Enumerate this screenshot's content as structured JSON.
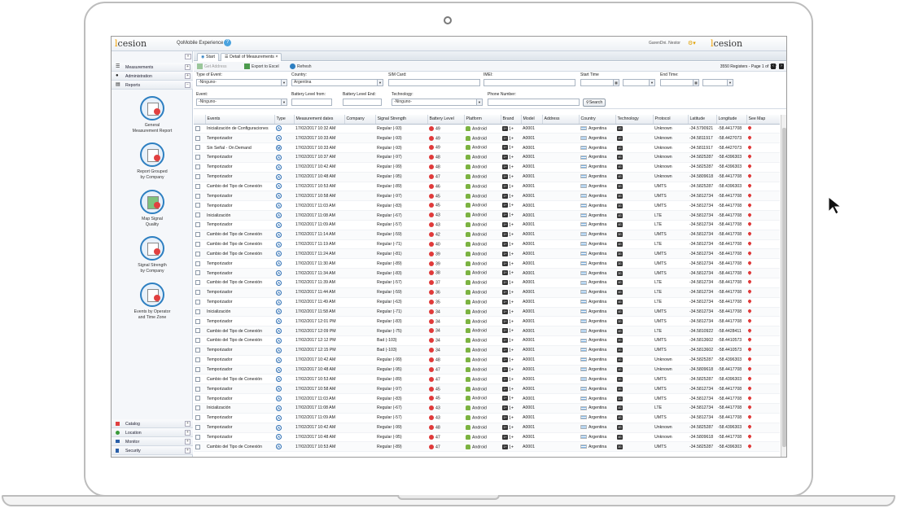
{
  "app": {
    "logo_text": "cesion",
    "title": "QoMobile Experience",
    "user": "GarenDni. Nestor"
  },
  "sidebar": {
    "sections": [
      {
        "label": "Measurements",
        "icon": "list-icon"
      },
      {
        "label": "Administration",
        "icon": "person-icon"
      },
      {
        "label": "Reports",
        "icon": "report-icon"
      }
    ],
    "reports": [
      {
        "label_line1": "General",
        "label_line2": "Measurement Report"
      },
      {
        "label_line1": "Report Grouped",
        "label_line2": "by Company"
      },
      {
        "label_line1": "Map Signal",
        "label_line2": "Quality"
      },
      {
        "label_line1": "Signal Strength",
        "label_line2": "by Company"
      },
      {
        "label_line1": "Events by Operator",
        "label_line2": "and Time Zone"
      }
    ],
    "bottom_sections": [
      {
        "label": "Catalog",
        "color": "#e04040"
      },
      {
        "label": "Location",
        "color": "#3a9a3a"
      },
      {
        "label": "Monitor",
        "color": "#2a5fa8"
      },
      {
        "label": "Security",
        "color": "#2a5fa8"
      }
    ]
  },
  "tabs": [
    {
      "label": "Start"
    },
    {
      "label": "Detail of Measurements"
    }
  ],
  "toolbar": {
    "get_address": "Get Address",
    "export": "Export to Excel",
    "refresh": "Refresh",
    "registers": "3550 Registers - Page 1 of 142"
  },
  "filters": {
    "type_of_event_label": "Type of Event:",
    "type_of_event_value": "-Ninguno-",
    "country_label": "Country:",
    "country_value": "Argentina",
    "sim_label": "SIM Card:",
    "imei_label": "IMEI:",
    "start_time_label": "Start Time",
    "end_time_label": "End Time:",
    "event_label": "Event:",
    "event_value": "-Ninguno-",
    "battery_from_label": "Battery Level from:",
    "battery_end_label": "Battery Level End:",
    "technology_label": "Technology:",
    "technology_value": "-Ninguno-",
    "phone_label": "Phone Number:",
    "search_label": "Search"
  },
  "table": {
    "columns": [
      "Events",
      "Type",
      "Measurement dates",
      "Company",
      "Signal Strength",
      "Battery Level",
      "Platform",
      "Brand",
      "Model",
      "Address",
      "Country",
      "Technology",
      "Protocol",
      "Latitude",
      "Longitude",
      "See Map"
    ],
    "rows": [
      {
        "event": "Inicialización de Configuraciones",
        "type": "A",
        "date": "17/02/2017 10:32 AM",
        "signal": "Regular (-93)",
        "battery": "49",
        "platform": "Android",
        "brand": "1+",
        "model": "A0001",
        "country": "Argentina",
        "tech": "4G",
        "protocol": "Unknown",
        "lat": "-34.5790921",
        "lon": "-58.4417708"
      },
      {
        "event": "Temporizador",
        "type": "A",
        "date": "17/02/2017 10:33 AM",
        "signal": "Regular (-93)",
        "battery": "49",
        "platform": "Android",
        "brand": "1+",
        "model": "A0001",
        "country": "Argentina",
        "tech": "4G",
        "protocol": "Unknown",
        "lat": "-34.5811917",
        "lon": "-58.4427073"
      },
      {
        "event": "Sin Señal - On Demand",
        "type": "M",
        "date": "17/02/2017 10:33 AM",
        "signal": "Regular (-93)",
        "battery": "49",
        "platform": "Android",
        "brand": "1+",
        "model": "A0001",
        "country": "Argentina",
        "tech": "4G",
        "protocol": "Unknown",
        "lat": "-34.5811917",
        "lon": "-58.4427073"
      },
      {
        "event": "Temporizador",
        "type": "A",
        "date": "17/02/2017 10:37 AM",
        "signal": "Regular (-97)",
        "battery": "48",
        "platform": "Android",
        "brand": "1+",
        "model": "A0001",
        "country": "Argentina",
        "tech": "4G",
        "protocol": "Unknown",
        "lat": "-34.5825287",
        "lon": "-58.4396303"
      },
      {
        "event": "Temporizador",
        "type": "A",
        "date": "17/02/2017 10:42 AM",
        "signal": "Regular (-99)",
        "battery": "48",
        "platform": "Android",
        "brand": "1+",
        "model": "A0001",
        "country": "Argentina",
        "tech": "4G",
        "protocol": "Unknown",
        "lat": "-34.5825287",
        "lon": "-58.4396303"
      },
      {
        "event": "Temporizador",
        "type": "A",
        "date": "17/02/2017 10:48 AM",
        "signal": "Regular (-95)",
        "battery": "47",
        "platform": "Android",
        "brand": "1+",
        "model": "A0001",
        "country": "Argentina",
        "tech": "4G",
        "protocol": "Unknown",
        "lat": "-34.5809618",
        "lon": "-58.4417708"
      },
      {
        "event": "Cambio del Tipo de Conexión",
        "type": "A",
        "date": "17/02/2017 10:53 AM",
        "signal": "Regular (-89)",
        "battery": "46",
        "platform": "Android",
        "brand": "1+",
        "model": "A0001",
        "country": "Argentina",
        "tech": "3G",
        "protocol": "UMTS",
        "lat": "-34.5825287",
        "lon": "-58.4396303"
      },
      {
        "event": "Temporizador",
        "type": "A",
        "date": "17/02/2017 10:58 AM",
        "signal": "Regular (-97)",
        "battery": "45",
        "platform": "Android",
        "brand": "1+",
        "model": "A0001",
        "country": "Argentina",
        "tech": "3G",
        "protocol": "UMTS",
        "lat": "-34.5812734",
        "lon": "-58.4417708"
      },
      {
        "event": "Temporizador",
        "type": "A",
        "date": "17/02/2017 11:03 AM",
        "signal": "Regular (-83)",
        "battery": "45",
        "platform": "Android",
        "brand": "1+",
        "model": "A0001",
        "country": "Argentina",
        "tech": "3G",
        "protocol": "UMTS",
        "lat": "-34.5812734",
        "lon": "-58.4417708"
      },
      {
        "event": "Inicialización",
        "type": "A",
        "date": "17/02/2017 11:08 AM",
        "signal": "Regular (-67)",
        "battery": "43",
        "platform": "Android",
        "brand": "1+",
        "model": "A0001",
        "country": "Argentina",
        "tech": "4G",
        "protocol": "LTE",
        "lat": "-34.5812734",
        "lon": "-58.4417708"
      },
      {
        "event": "Temporizador",
        "type": "A",
        "date": "17/02/2017 11:09 AM",
        "signal": "Regular (-57)",
        "battery": "43",
        "platform": "Android",
        "brand": "1+",
        "model": "A0001",
        "country": "Argentina",
        "tech": "4G",
        "protocol": "LTE",
        "lat": "-34.5812734",
        "lon": "-58.4417708"
      },
      {
        "event": "Cambio del Tipo de Conexión",
        "type": "A",
        "date": "17/02/2017 11:14 AM",
        "signal": "Regular (-59)",
        "battery": "42",
        "platform": "Android",
        "brand": "1+",
        "model": "A0001",
        "country": "Argentina",
        "tech": "3G",
        "protocol": "UMTS",
        "lat": "-34.5812734",
        "lon": "-58.4417708"
      },
      {
        "event": "Cambio del Tipo de Conexión",
        "type": "A",
        "date": "17/02/2017 11:19 AM",
        "signal": "Regular (-71)",
        "battery": "40",
        "platform": "Android",
        "brand": "1+",
        "model": "A0001",
        "country": "Argentina",
        "tech": "4G",
        "protocol": "LTE",
        "lat": "-34.5812734",
        "lon": "-58.4417708"
      },
      {
        "event": "Cambio del Tipo de Conexión",
        "type": "A",
        "date": "17/02/2017 11:24 AM",
        "signal": "Regular (-81)",
        "battery": "39",
        "platform": "Android",
        "brand": "1+",
        "model": "A0001",
        "country": "Argentina",
        "tech": "3G",
        "protocol": "UMTS",
        "lat": "-34.5812734",
        "lon": "-58.4417708"
      },
      {
        "event": "Temporizador",
        "type": "A",
        "date": "17/02/2017 11:30 AM",
        "signal": "Regular (-89)",
        "battery": "39",
        "platform": "Android",
        "brand": "1+",
        "model": "A0001",
        "country": "Argentina",
        "tech": "3G",
        "protocol": "UMTS",
        "lat": "-34.5812734",
        "lon": "-58.4417708"
      },
      {
        "event": "Temporizador",
        "type": "A",
        "date": "17/02/2017 11:34 AM",
        "signal": "Regular (-83)",
        "battery": "38",
        "platform": "Android",
        "brand": "1+",
        "model": "A0001",
        "country": "Argentina",
        "tech": "3G",
        "protocol": "UMTS",
        "lat": "-34.5812734",
        "lon": "-58.4417708"
      },
      {
        "event": "Cambio del Tipo de Conexión",
        "type": "A",
        "date": "17/02/2017 11:39 AM",
        "signal": "Regular (-57)",
        "battery": "37",
        "platform": "Android",
        "brand": "1+",
        "model": "A0001",
        "country": "Argentina",
        "tech": "4G",
        "protocol": "LTE",
        "lat": "-34.5812734",
        "lon": "-58.4417708"
      },
      {
        "event": "Temporizador",
        "type": "A",
        "date": "17/02/2017 11:44 AM",
        "signal": "Regular (-59)",
        "battery": "36",
        "platform": "Android",
        "brand": "1+",
        "model": "A0001",
        "country": "Argentina",
        "tech": "4G",
        "protocol": "LTE",
        "lat": "-34.5812734",
        "lon": "-58.4417708"
      },
      {
        "event": "Temporizador",
        "type": "A",
        "date": "17/02/2017 11:49 AM",
        "signal": "Regular (-63)",
        "battery": "35",
        "platform": "Android",
        "brand": "1+",
        "model": "A0001",
        "country": "Argentina",
        "tech": "4G",
        "protocol": "LTE",
        "lat": "-34.5812734",
        "lon": "-58.4417708"
      },
      {
        "event": "Inicialización",
        "type": "A",
        "date": "17/02/2017 11:58 AM",
        "signal": "Regular (-71)",
        "battery": "34",
        "platform": "Android",
        "brand": "1+",
        "model": "A0001",
        "country": "Argentina",
        "tech": "4G",
        "protocol": "UMTS",
        "lat": "-34.5812734",
        "lon": "-58.4417708"
      },
      {
        "event": "Temporizador",
        "type": "A",
        "date": "17/02/2017 12:01 PM",
        "signal": "Regular (-83)",
        "battery": "34",
        "platform": "Android",
        "brand": "1+",
        "model": "A0001",
        "country": "Argentina",
        "tech": "3G",
        "protocol": "UMTS",
        "lat": "-34.5812734",
        "lon": "-58.4417708"
      },
      {
        "event": "Cambio del Tipo de Conexión",
        "type": "A",
        "date": "17/02/2017 12:09 PM",
        "signal": "Regular (-75)",
        "battery": "34",
        "platform": "Android",
        "brand": "1+",
        "model": "A0001",
        "country": "Argentina",
        "tech": "4G",
        "protocol": "LTE",
        "lat": "-34.5810922",
        "lon": "-58.4428411"
      },
      {
        "event": "Cambio del Tipo de Conexión",
        "type": "A",
        "date": "17/02/2017 12:12 PM",
        "signal": "Bad (-103)",
        "battery": "34",
        "platform": "Android",
        "brand": "1+",
        "model": "A0001",
        "country": "Argentina",
        "tech": "3G",
        "protocol": "UMTS",
        "lat": "-34.5813602",
        "lon": "-58.4410573"
      },
      {
        "event": "Temporizador",
        "type": "A",
        "date": "17/02/2017 12:15 PM",
        "signal": "Bad (-103)",
        "battery": "34",
        "platform": "Android",
        "brand": "1+",
        "model": "A0001",
        "country": "Argentina",
        "tech": "3G",
        "protocol": "UMTS",
        "lat": "-34.5813602",
        "lon": "-58.4410573"
      },
      {
        "event": "Temporizador",
        "type": "A",
        "date": "17/02/2017 10:42 AM",
        "signal": "Regular (-99)",
        "battery": "48",
        "platform": "Android",
        "brand": "1+",
        "model": "A0001",
        "country": "Argentina",
        "tech": "4G",
        "protocol": "Unknown",
        "lat": "-34.5825287",
        "lon": "-58.4396303"
      },
      {
        "event": "Temporizador",
        "type": "A",
        "date": "17/02/2017 10:48 AM",
        "signal": "Regular (-95)",
        "battery": "47",
        "platform": "Android",
        "brand": "1+",
        "model": "A0001",
        "country": "Argentina",
        "tech": "4G",
        "protocol": "Unknown",
        "lat": "-34.5809618",
        "lon": "-58.4417708"
      },
      {
        "event": "Cambio del Tipo de Conexión",
        "type": "A",
        "date": "17/02/2017 10:53 AM",
        "signal": "Regular (-89)",
        "battery": "47",
        "platform": "Android",
        "brand": "1+",
        "model": "A0001",
        "country": "Argentina",
        "tech": "3G",
        "protocol": "UMTS",
        "lat": "-34.5825287",
        "lon": "-58.4396303"
      },
      {
        "event": "Temporizador",
        "type": "A",
        "date": "17/02/2017 10:58 AM",
        "signal": "Regular (-97)",
        "battery": "45",
        "platform": "Android",
        "brand": "1+",
        "model": "A0001",
        "country": "Argentina",
        "tech": "3G",
        "protocol": "UMTS",
        "lat": "-34.5812734",
        "lon": "-58.4417708"
      },
      {
        "event": "Temporizador",
        "type": "A",
        "date": "17/02/2017 11:03 AM",
        "signal": "Regular (-83)",
        "battery": "45",
        "platform": "Android",
        "brand": "1+",
        "model": "A0001",
        "country": "Argentina",
        "tech": "3G",
        "protocol": "UMTS",
        "lat": "-34.5812734",
        "lon": "-58.4417708"
      },
      {
        "event": "Inicialización",
        "type": "A",
        "date": "17/02/2017 11:08 AM",
        "signal": "Regular (-67)",
        "battery": "43",
        "platform": "Android",
        "brand": "1+",
        "model": "A0001",
        "country": "Argentina",
        "tech": "4G",
        "protocol": "LTE",
        "lat": "-34.5812734",
        "lon": "-58.4417708"
      },
      {
        "event": "Temporizador",
        "type": "A",
        "date": "17/02/2017 11:09 AM",
        "signal": "Regular (-57)",
        "battery": "43",
        "platform": "Android",
        "brand": "1+",
        "model": "A0001",
        "country": "Argentina",
        "tech": "4G",
        "protocol": "UMTS",
        "lat": "-34.5812734",
        "lon": "-58.4417708"
      },
      {
        "event": "Temporizador",
        "type": "A",
        "date": "17/02/2017 10:42 AM",
        "signal": "Regular (-99)",
        "battery": "48",
        "platform": "Android",
        "brand": "1+",
        "model": "A0001",
        "country": "Argentina",
        "tech": "4G",
        "protocol": "Unknown",
        "lat": "-34.5825287",
        "lon": "-58.4396303"
      },
      {
        "event": "Temporizador",
        "type": "A",
        "date": "17/02/2017 10:48 AM",
        "signal": "Regular (-95)",
        "battery": "47",
        "platform": "Android",
        "brand": "1+",
        "model": "A0001",
        "country": "Argentina",
        "tech": "4G",
        "protocol": "Unknown",
        "lat": "-34.5809618",
        "lon": "-58.4417708"
      },
      {
        "event": "Cambio del Tipo de Conexión",
        "type": "A",
        "date": "17/02/2017 10:53 AM",
        "signal": "Regular (-89)",
        "battery": "47",
        "platform": "Android",
        "brand": "1+",
        "model": "A0001",
        "country": "Argentina",
        "tech": "3G",
        "protocol": "UMTS",
        "lat": "-34.5825287",
        "lon": "-58.4396303"
      }
    ]
  },
  "colors": {
    "accent": "#2d7fc1",
    "battery": "#e03a3a",
    "android": "#7cb342"
  }
}
